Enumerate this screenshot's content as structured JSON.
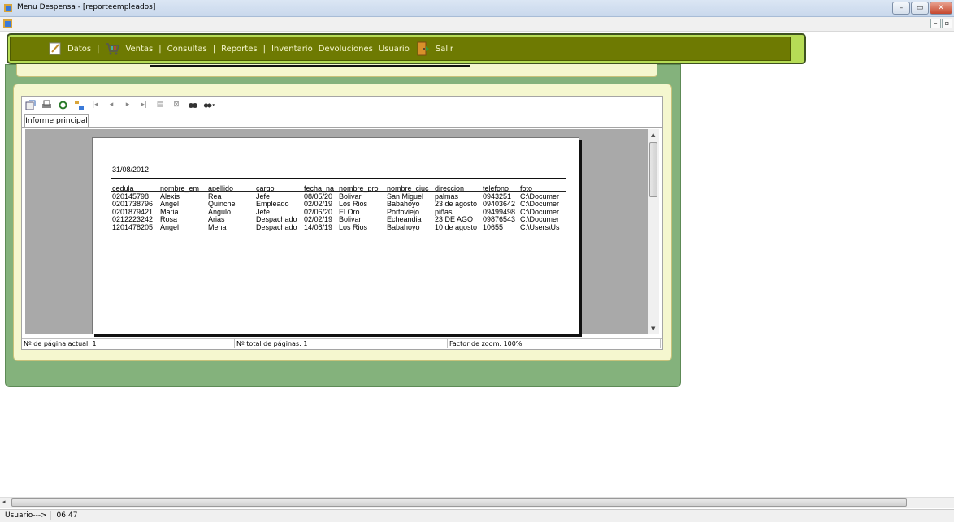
{
  "window": {
    "title": "Menu Despensa - [reporteempleados]",
    "minimize": "–",
    "maximize": "▭",
    "close": "✕"
  },
  "mdi": {
    "minimize": "–",
    "restore": "▫"
  },
  "menu": {
    "items": [
      {
        "label": "Datos"
      },
      {
        "label": "|"
      },
      {
        "label": "Ventas"
      },
      {
        "label": "|"
      },
      {
        "label": "Consultas"
      },
      {
        "label": "|"
      },
      {
        "label": "Reportes"
      },
      {
        "label": "|"
      },
      {
        "label": "Inventario"
      },
      {
        "label": "Devoluciones"
      },
      {
        "label": "Usuario"
      },
      {
        "label": "Salir"
      }
    ]
  },
  "report": {
    "tab": "Informe principal",
    "date": "31/08/2012",
    "columns": [
      "cedula",
      "nombre_em",
      "apellido",
      "cargo",
      "fecha_na",
      "nombre_pro",
      "nombre_ciuc",
      "direccion",
      "telefono",
      "foto"
    ],
    "rows": [
      [
        "020145798",
        "Alexis",
        "Rea",
        "Jefe",
        "08/05/20",
        "Bolivar",
        "San Miguel",
        "palmas",
        "0943251",
        "C:\\Documer"
      ],
      [
        "0201738796",
        "Angel",
        "Quinche",
        "Empleado",
        "02/02/19",
        "Los Rios",
        "Babahoyo",
        "23 de agosto",
        "09403642",
        "C:\\Documer"
      ],
      [
        "0201879421",
        "Maria",
        "Angulo",
        "Jefe",
        "02/06/20",
        "El Oro",
        "Portoviejo",
        "piñas",
        "09499498",
        "C:\\Documer"
      ],
      [
        "0212223242",
        "Rosa",
        "Arias",
        "Despachado",
        "02/02/19",
        "Bolivar",
        "Echeandia",
        "23 DE AGO",
        "09876543",
        "C:\\Documer"
      ],
      [
        "1201478205",
        "Angel",
        "Mena",
        "Despachado",
        "14/08/19",
        "Los Rios",
        "Babahoyo",
        "10 de agosto",
        "10655",
        "C:\\Users\\Us"
      ]
    ]
  },
  "viewer_status": {
    "page_current": "Nº de página actual: 1",
    "page_total": "Nº total de páginas: 1",
    "zoom": "Factor de zoom: 100%"
  },
  "statusbar": {
    "user": "Usuario--->",
    "time": "06:47"
  }
}
